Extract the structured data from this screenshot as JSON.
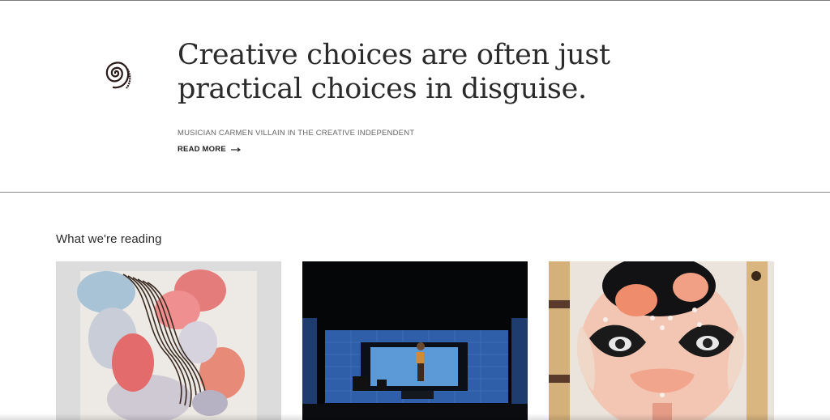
{
  "feature": {
    "quote": "Creative choices are often just practical choices in disguise.",
    "attribution": "MUSICIAN CARMEN VILLAIN IN THE CREATIVE INDEPENDENT",
    "read_more_label": "READ MORE",
    "icon": "spiral-icon"
  },
  "reading": {
    "title": "What we're reading",
    "cards": [
      {
        "image": "abstract-painting-image"
      },
      {
        "image": "stage-performance-image"
      },
      {
        "image": "face-mask-portrait-image"
      }
    ]
  },
  "colors": {
    "text_primary": "#2b2b2b",
    "text_muted": "#666666",
    "divider": "#8a8a8a"
  }
}
